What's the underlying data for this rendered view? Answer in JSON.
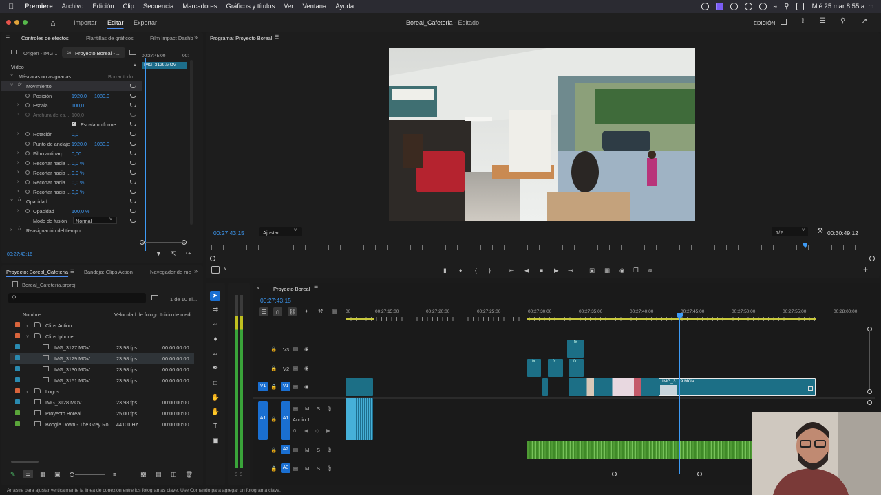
{
  "menubar": {
    "app": "Premiere",
    "items": [
      "Archivo",
      "Edición",
      "Clip",
      "Secuencia",
      "Marcadores",
      "Gráficos y títulos",
      "Ver",
      "Ventana",
      "Ayuda"
    ],
    "clock": "Mié 25 mar 8:55 a. m."
  },
  "header": {
    "nav": [
      "Importar",
      "Editar",
      "Exportar"
    ],
    "active_nav": "Editar",
    "title": "Boreal_Cafeteria",
    "title_suffix": " - Editado",
    "workspace": "EDICIÓN"
  },
  "effects": {
    "tabs": [
      "Controles de efectos",
      "Plantillas de gráficos",
      "Film Impact Dashb"
    ],
    "sources": [
      "Origen - IMG...",
      "Proyecto Boreal - ..."
    ],
    "mini_time": [
      "00:27:45:00",
      "00:"
    ],
    "mini_clip": "IMG_3129.MOV",
    "section_video": "Vídeo",
    "masks": "Máscaras no asignadas",
    "clear_all": "Borrar todo",
    "movimiento": "Movimiento",
    "posicion": "Posición",
    "pos_x": "1920,0",
    "pos_y": "1080,0",
    "escala": "Escala",
    "escala_val": "100,0",
    "anchura": "Anchura de es...",
    "anchura_val": "100,0",
    "uniform": "Escala uniforme",
    "rotacion": "Rotación",
    "rot_val": "0,0",
    "anchor": "Punto de anclaje",
    "anchor_x": "1920,0",
    "anchor_y": "1080,0",
    "filtro": "Filtro antiparp...",
    "filtro_val": "0,00",
    "crop": [
      "Recortar hacia ...",
      "Recortar hacia ...",
      "Recortar hacia ...",
      "Recortar hacia ..."
    ],
    "crop_vals": [
      "0,0 %",
      "0,0 %",
      "0,0 %",
      "0,0 %"
    ],
    "opacidad_group": "Opacidad",
    "opacidad": "Opacidad",
    "opacidad_val": "100,0 %",
    "fusion": "Modo de fusión",
    "fusion_val": "Normal",
    "reasignacion": "Reasignación del tiempo",
    "timecode": "00:27:43:16"
  },
  "program": {
    "tab": "Programa: Proyecto Boreal",
    "timecode": "00:27:43:15",
    "fit": "Ajustar",
    "resolution": "1/2",
    "duration": "00:30:49:12"
  },
  "project": {
    "tabs": [
      "Proyecto: Boreal_Cafeteria",
      "Bandeja: Clips Action",
      "Navegador de me"
    ],
    "file": "Boreal_Cafeteria.prproj",
    "count": "1 de 10 el...",
    "columns": [
      "Nombre",
      "Velocidad de fotogr",
      "Inicio de medi"
    ],
    "items": [
      {
        "name": "Clips Action",
        "fps": "",
        "start": "",
        "color": "#d8643c",
        "indent": 0,
        "kind": "folder",
        "open": false
      },
      {
        "name": "Clips Iphone",
        "fps": "",
        "start": "",
        "color": "#d8643c",
        "indent": 0,
        "kind": "folder",
        "open": true
      },
      {
        "name": "IMG_3127.MOV",
        "fps": "23,98 fps",
        "start": "00:00:00:00",
        "color": "#2a8ab0",
        "indent": 1,
        "kind": "clip"
      },
      {
        "name": "IMG_3129.MOV",
        "fps": "23,98 fps",
        "start": "00:00:00:00",
        "color": "#2a8ab0",
        "indent": 1,
        "kind": "clip",
        "selected": true
      },
      {
        "name": "IMG_3130.MOV",
        "fps": "23,98 fps",
        "start": "00:00:00:00",
        "color": "#2a8ab0",
        "indent": 1,
        "kind": "clip"
      },
      {
        "name": "IMG_3151.MOV",
        "fps": "23,98 fps",
        "start": "00:00:00:00",
        "color": "#2a8ab0",
        "indent": 1,
        "kind": "clip"
      },
      {
        "name": "Logos",
        "fps": "",
        "start": "",
        "color": "#d8643c",
        "indent": 0,
        "kind": "folder",
        "open": false
      },
      {
        "name": "IMG_3128.MOV",
        "fps": "23,98 fps",
        "start": "00:00:00:00",
        "color": "#2a8ab0",
        "indent": 0,
        "kind": "clip"
      },
      {
        "name": "Proyecto Boreal",
        "fps": "25,00 fps",
        "start": "00:00:00:00",
        "color": "#5aa53a",
        "indent": 0,
        "kind": "seq"
      },
      {
        "name": "Boogie Down - The Grey Ro",
        "fps": "44100 Hz",
        "start": "00:00:00:00",
        "color": "#5aa53a",
        "indent": 0,
        "kind": "audio"
      }
    ]
  },
  "timeline": {
    "tab": "Proyecto Boreal",
    "timecode": "00:27:43:15",
    "ruler": [
      "00",
      "00:27:15:00",
      "00:27:20:00",
      "00:27:25:00",
      "00:27:30:00",
      "00:27:35:00",
      "00:27:40:00",
      "00:27:45:00",
      "00:27:50:00",
      "00:27:55:00",
      "00:28:00:00"
    ],
    "tracks_video": [
      "V3",
      "V2",
      "V1"
    ],
    "tracks_audio": [
      "A1",
      "A2",
      "A3"
    ],
    "audio1_name": "Audio 1",
    "clip_selected": "IMG_3129.MOV",
    "fx": "fx",
    "meter_bottom": [
      "S",
      "S"
    ]
  },
  "status": "Arrastre para ajustar verticalmente la línea de conexión entre los fotogramas clave. Use Comando para agregar un fotograma clave.",
  "colors": {
    "accent": "#3d9af5",
    "video_clip": "#1c6f86",
    "audio_clip": "#4e9a33",
    "selection": "#2a5fa8"
  }
}
